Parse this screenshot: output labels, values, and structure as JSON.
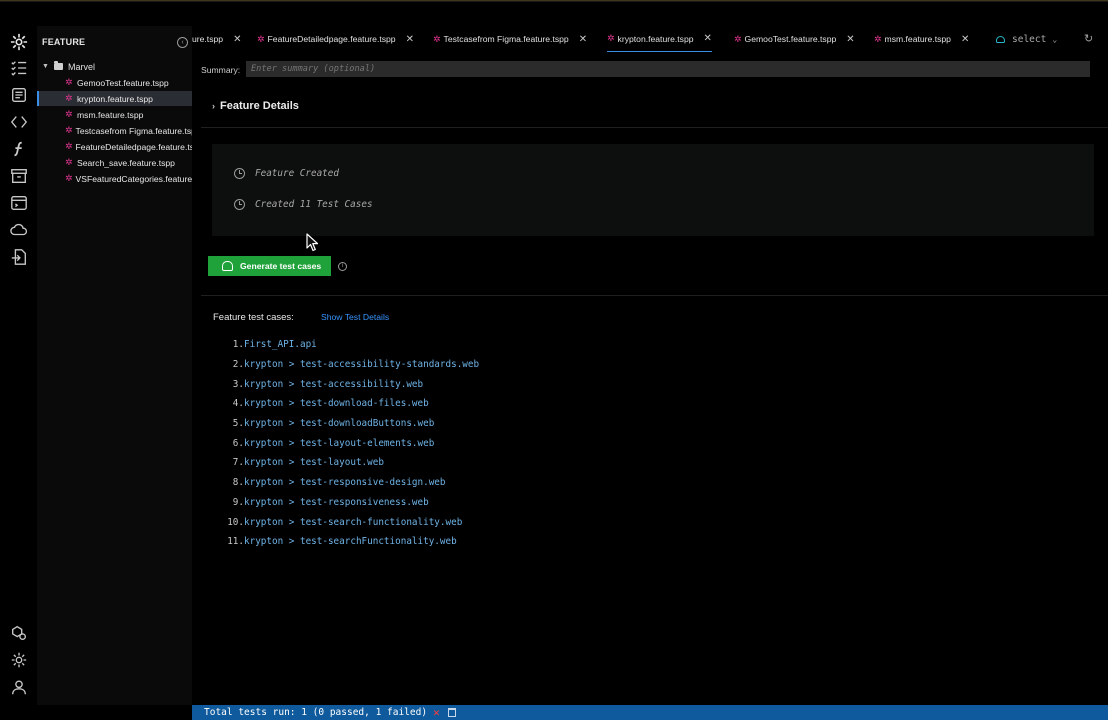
{
  "sidebar": {
    "title": "FEATURE",
    "folder": "Marvel",
    "items": [
      {
        "label": "GemooTest.feature.tspp",
        "active": false
      },
      {
        "label": "krypton.feature.tspp",
        "active": true
      },
      {
        "label": "msm.feature.tspp",
        "active": false
      },
      {
        "label": "Testcasefrom Figma.feature.tspp",
        "active": false
      },
      {
        "label": "FeatureDetailedpage.feature.tspp",
        "active": false
      },
      {
        "label": "Search_save.feature.tspp",
        "active": false
      },
      {
        "label": "VSFeaturedCategories.feature.tspp",
        "active": false
      }
    ]
  },
  "tabs": [
    {
      "label": "ure.tspp",
      "active": false,
      "gear": false
    },
    {
      "label": "FeatureDetailedpage.feature.tspp",
      "active": false,
      "gear": true
    },
    {
      "label": "Testcasefrom Figma.feature.tspp",
      "active": false,
      "gear": true
    },
    {
      "label": "krypton.feature.tspp",
      "active": true,
      "gear": true
    },
    {
      "label": "GemooTest.feature.tspp",
      "active": false,
      "gear": true
    },
    {
      "label": "msm.feature.tspp",
      "active": false,
      "gear": true
    }
  ],
  "tab_select": "select",
  "summary": {
    "label": "Summary:",
    "placeholder": "Enter summary (optional)"
  },
  "feature_details": {
    "heading": "Feature Details",
    "events": [
      "Feature Created",
      "Created 11 Test Cases"
    ]
  },
  "generate_button": "Generate test cases",
  "test_cases": {
    "title": "Feature test cases:",
    "show_details": "Show Test Details",
    "items": [
      {
        "num": "1.",
        "name": "First_API.api"
      },
      {
        "num": "2.",
        "name": "krypton > test-accessibility-standards.web"
      },
      {
        "num": "3.",
        "name": "krypton > test-accessibility.web"
      },
      {
        "num": "4.",
        "name": "krypton > test-download-files.web"
      },
      {
        "num": "5.",
        "name": "krypton > test-downloadButtons.web"
      },
      {
        "num": "6.",
        "name": "krypton > test-layout-elements.web"
      },
      {
        "num": "7.",
        "name": "krypton > test-layout.web"
      },
      {
        "num": "8.",
        "name": "krypton > test-responsive-design.web"
      },
      {
        "num": "9.",
        "name": "krypton > test-responsiveness.web"
      },
      {
        "num": "10.",
        "name": "krypton > test-search-functionality.web"
      },
      {
        "num": "11.",
        "name": "krypton > test-searchFunctionality.web"
      }
    ]
  },
  "status": {
    "text": "Total tests run: 1 (0 passed, 1 failed)"
  },
  "icons": {
    "brand": "gear-logo-icon",
    "status_fail": "x-icon",
    "status_clear": "trash-icon"
  },
  "colors": {
    "accent": "#3a8ee6",
    "gear": "#e0368f",
    "primary_button": "#1fa23a",
    "statusbar": "#0f5a9c",
    "link": "#3794ff",
    "fail": "#ff3b3b"
  }
}
